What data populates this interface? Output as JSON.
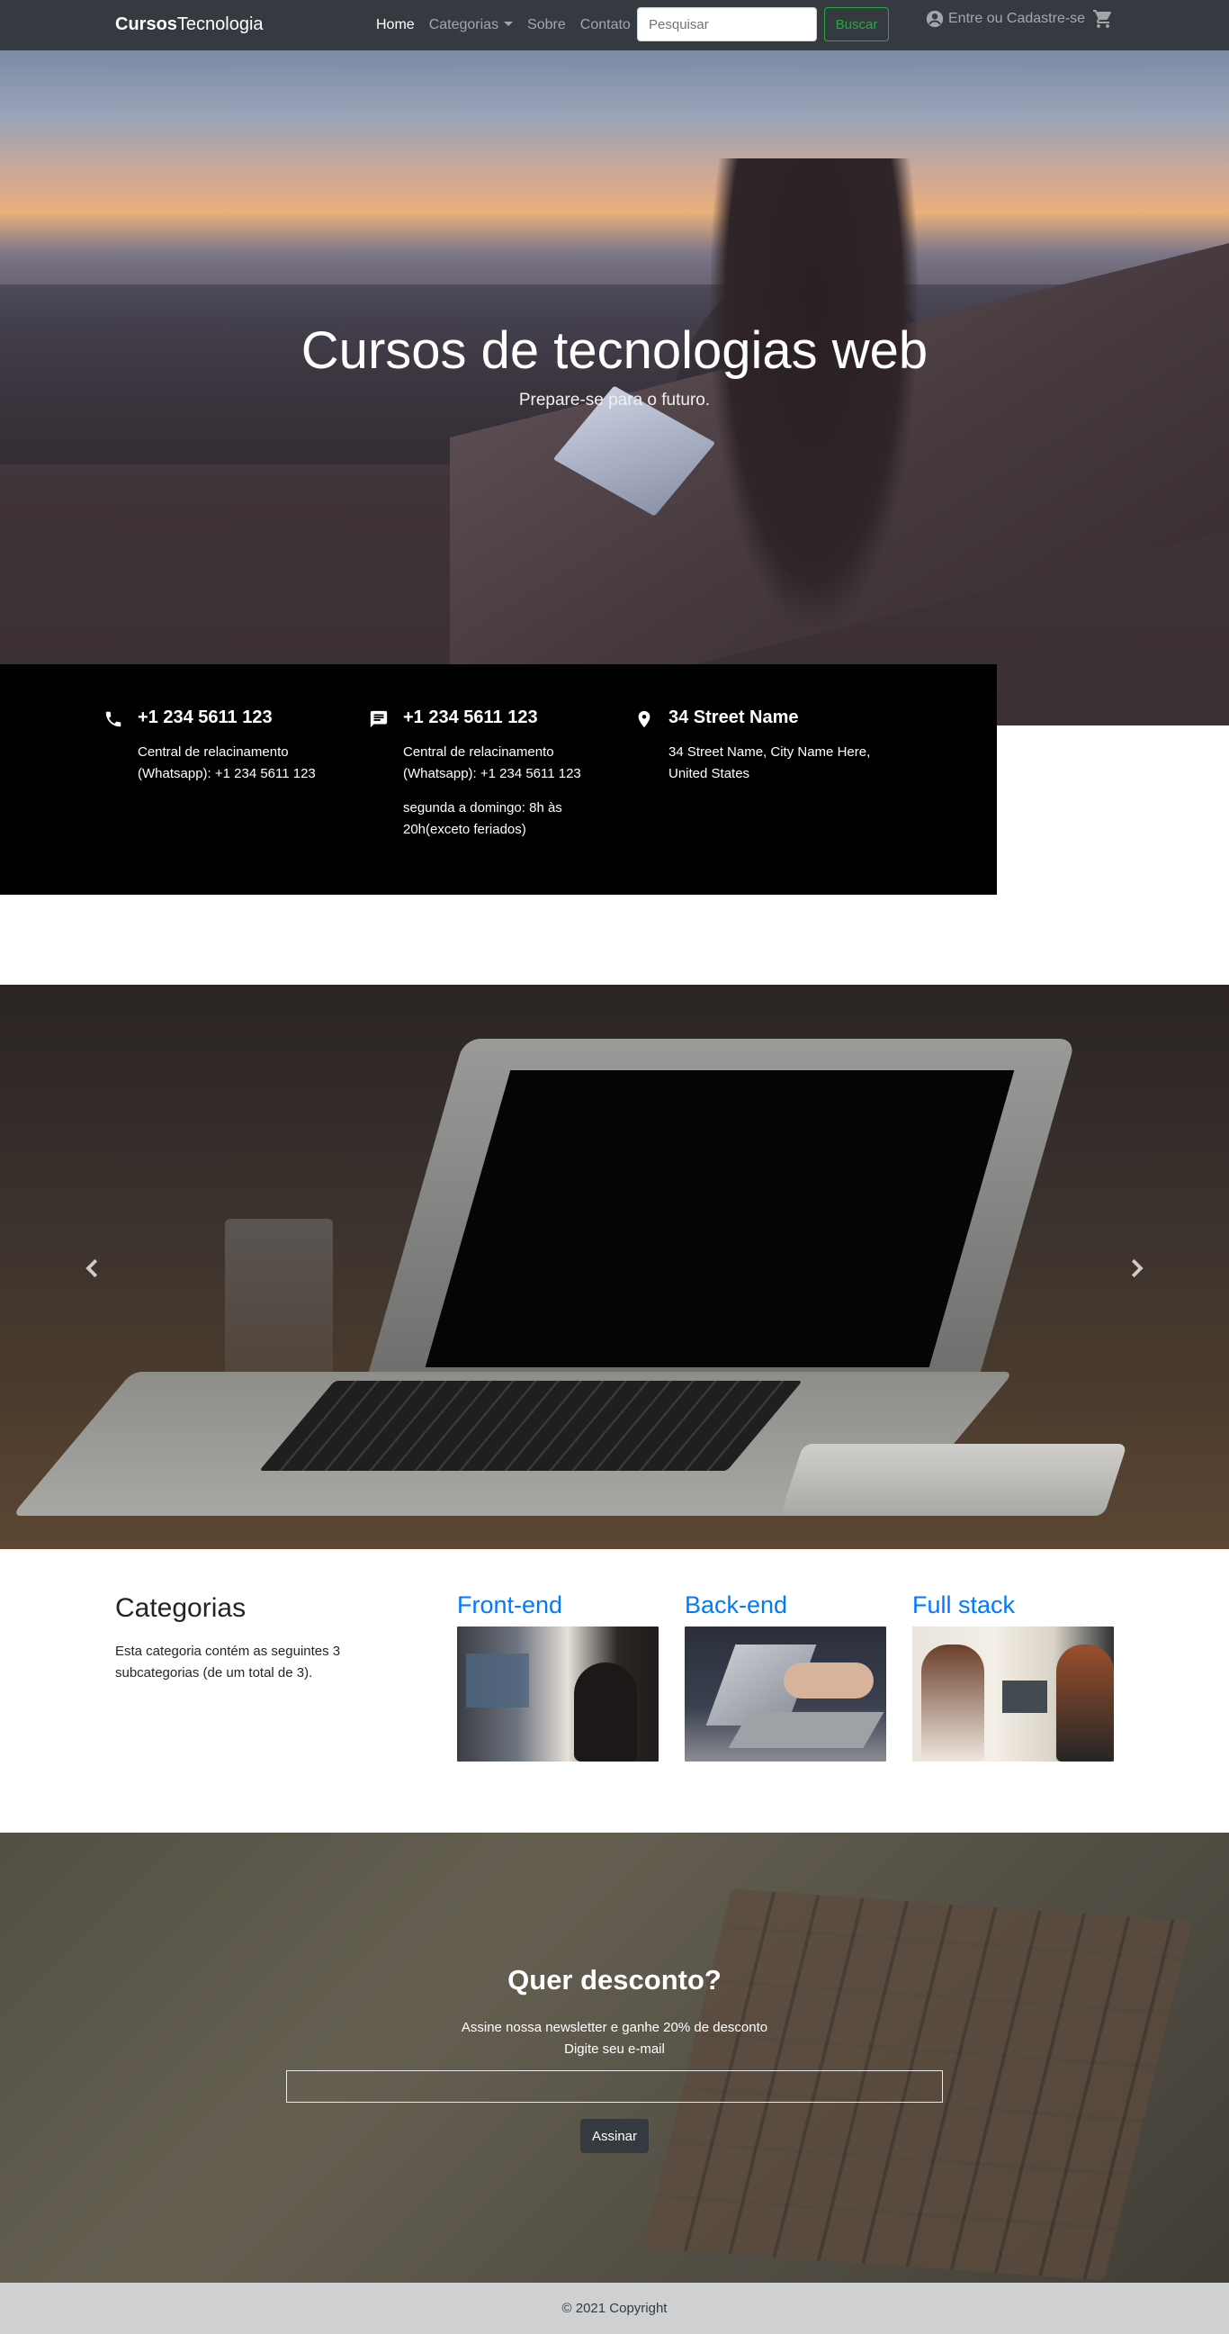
{
  "navbar": {
    "brand_bold": "Cursos",
    "brand_rest": "Tecnologia",
    "links": [
      {
        "label": "Home"
      },
      {
        "label": "Categorias"
      },
      {
        "label": "Sobre"
      },
      {
        "label": "Contato"
      }
    ],
    "search": {
      "placeholder": "Pesquisar",
      "value": "",
      "button_label": "Buscar"
    },
    "login_label": "Entre ou Cadastre-se",
    "icons": {
      "user": "account-circle-icon",
      "cart": "shopping-cart-icon"
    }
  },
  "hero": {
    "title": "Cursos de tecnologias web",
    "subtitle": "Prepare-se para o futuro."
  },
  "contact": [
    {
      "icon": "phone-icon",
      "title": "+1 234 5611 123",
      "lines": [
        "Central de relacinamento (Whatsapp): +1 234 5611 123"
      ]
    },
    {
      "icon": "message-icon",
      "title": "+1 234 5611 123",
      "lines": [
        "Central de relacinamento (Whatsapp): +1 234 5611 123",
        "segunda a domingo: 8h às 20h(exceto feriados)"
      ]
    },
    {
      "icon": "location-pin-icon",
      "title": "34 Street Name",
      "lines": [
        "34 Street Name, City Name Here, United States"
      ]
    }
  ],
  "carousel": {
    "icons": {
      "prev": "chevron-left-icon",
      "next": "chevron-right-icon"
    }
  },
  "categories": {
    "title": "Categorias",
    "description": "Esta categoria contém as seguintes 3 subcategorias (de um total de 3).",
    "items": [
      {
        "label": "Front-end"
      },
      {
        "label": "Back-end"
      },
      {
        "label": "Full stack"
      }
    ]
  },
  "newsletter": {
    "title": "Quer desconto?",
    "subtitle": "Assine nossa newsletter e ganhe 20% de desconto",
    "input_label": "Digite seu e-mail",
    "input_value": "",
    "button_label": "Assinar"
  },
  "footer": {
    "copyright": "© 2021 Copyright"
  },
  "colors": {
    "navbar": "#343a40",
    "accent_link": "#007bff",
    "search_button": "#28a745",
    "footer": "#ced0d2"
  }
}
